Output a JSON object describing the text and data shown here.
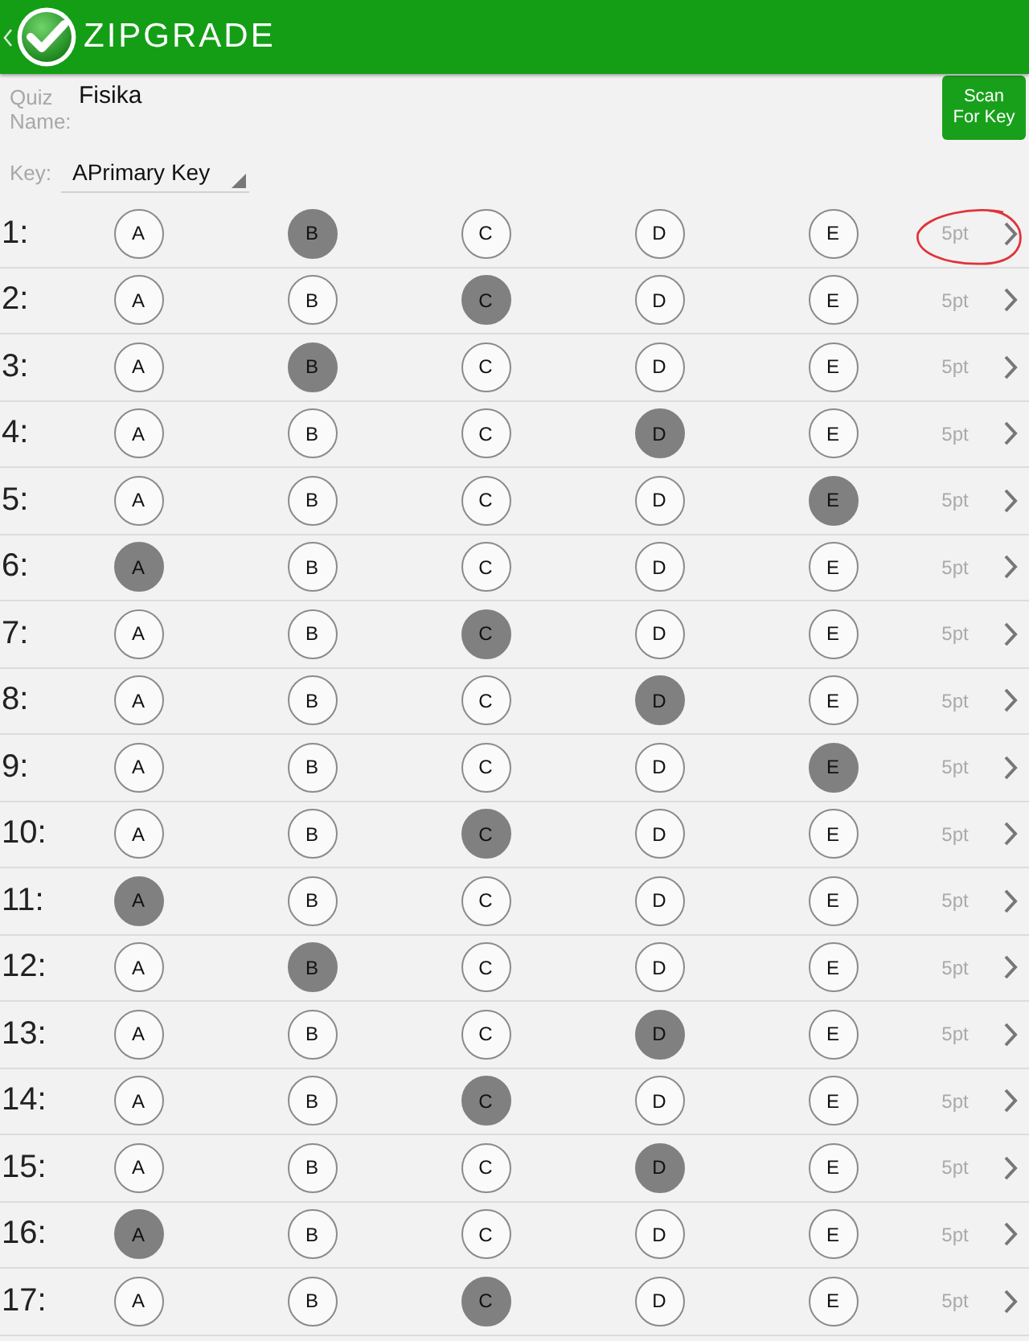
{
  "app_bar": {
    "title": "ZIPGRADE"
  },
  "quiz": {
    "name_label": "Quiz Name:",
    "name": "Fisika",
    "scan_button": "Scan For Key",
    "key_label": "Key:",
    "key": "APrimary Key"
  },
  "questions": [
    {
      "number": "1:",
      "choices": [
        {
          "label": "A",
          "selected": false
        },
        {
          "label": "B",
          "selected": true
        },
        {
          "label": "C",
          "selected": false
        },
        {
          "label": "D",
          "selected": false
        },
        {
          "label": "E",
          "selected": false
        }
      ],
      "points": "5pt",
      "circled": true
    },
    {
      "number": "2:",
      "choices": [
        {
          "label": "A",
          "selected": false
        },
        {
          "label": "B",
          "selected": false
        },
        {
          "label": "C",
          "selected": true
        },
        {
          "label": "D",
          "selected": false
        },
        {
          "label": "E",
          "selected": false
        }
      ],
      "points": "5pt",
      "circled": false
    },
    {
      "number": "3:",
      "choices": [
        {
          "label": "A",
          "selected": false
        },
        {
          "label": "B",
          "selected": true
        },
        {
          "label": "C",
          "selected": false
        },
        {
          "label": "D",
          "selected": false
        },
        {
          "label": "E",
          "selected": false
        }
      ],
      "points": "5pt",
      "circled": false
    },
    {
      "number": "4:",
      "choices": [
        {
          "label": "A",
          "selected": false
        },
        {
          "label": "B",
          "selected": false
        },
        {
          "label": "C",
          "selected": false
        },
        {
          "label": "D",
          "selected": true
        },
        {
          "label": "E",
          "selected": false
        }
      ],
      "points": "5pt",
      "circled": false
    },
    {
      "number": "5:",
      "choices": [
        {
          "label": "A",
          "selected": false
        },
        {
          "label": "B",
          "selected": false
        },
        {
          "label": "C",
          "selected": false
        },
        {
          "label": "D",
          "selected": false
        },
        {
          "label": "E",
          "selected": true
        }
      ],
      "points": "5pt",
      "circled": false
    },
    {
      "number": "6:",
      "choices": [
        {
          "label": "A",
          "selected": true
        },
        {
          "label": "B",
          "selected": false
        },
        {
          "label": "C",
          "selected": false
        },
        {
          "label": "D",
          "selected": false
        },
        {
          "label": "E",
          "selected": false
        }
      ],
      "points": "5pt",
      "circled": false
    },
    {
      "number": "7:",
      "choices": [
        {
          "label": "A",
          "selected": false
        },
        {
          "label": "B",
          "selected": false
        },
        {
          "label": "C",
          "selected": true
        },
        {
          "label": "D",
          "selected": false
        },
        {
          "label": "E",
          "selected": false
        }
      ],
      "points": "5pt",
      "circled": false
    },
    {
      "number": "8:",
      "choices": [
        {
          "label": "A",
          "selected": false
        },
        {
          "label": "B",
          "selected": false
        },
        {
          "label": "C",
          "selected": false
        },
        {
          "label": "D",
          "selected": true
        },
        {
          "label": "E",
          "selected": false
        }
      ],
      "points": "5pt",
      "circled": false
    },
    {
      "number": "9:",
      "choices": [
        {
          "label": "A",
          "selected": false
        },
        {
          "label": "B",
          "selected": false
        },
        {
          "label": "C",
          "selected": false
        },
        {
          "label": "D",
          "selected": false
        },
        {
          "label": "E",
          "selected": true
        }
      ],
      "points": "5pt",
      "circled": false
    },
    {
      "number": "10:",
      "choices": [
        {
          "label": "A",
          "selected": false
        },
        {
          "label": "B",
          "selected": false
        },
        {
          "label": "C",
          "selected": true
        },
        {
          "label": "D",
          "selected": false
        },
        {
          "label": "E",
          "selected": false
        }
      ],
      "points": "5pt",
      "circled": false
    },
    {
      "number": "11:",
      "choices": [
        {
          "label": "A",
          "selected": true
        },
        {
          "label": "B",
          "selected": false
        },
        {
          "label": "C",
          "selected": false
        },
        {
          "label": "D",
          "selected": false
        },
        {
          "label": "E",
          "selected": false
        }
      ],
      "points": "5pt",
      "circled": false
    },
    {
      "number": "12:",
      "choices": [
        {
          "label": "A",
          "selected": false
        },
        {
          "label": "B",
          "selected": true
        },
        {
          "label": "C",
          "selected": false
        },
        {
          "label": "D",
          "selected": false
        },
        {
          "label": "E",
          "selected": false
        }
      ],
      "points": "5pt",
      "circled": false
    },
    {
      "number": "13:",
      "choices": [
        {
          "label": "A",
          "selected": false
        },
        {
          "label": "B",
          "selected": false
        },
        {
          "label": "C",
          "selected": false
        },
        {
          "label": "D",
          "selected": true
        },
        {
          "label": "E",
          "selected": false
        }
      ],
      "points": "5pt",
      "circled": false
    },
    {
      "number": "14:",
      "choices": [
        {
          "label": "A",
          "selected": false
        },
        {
          "label": "B",
          "selected": false
        },
        {
          "label": "C",
          "selected": true
        },
        {
          "label": "D",
          "selected": false
        },
        {
          "label": "E",
          "selected": false
        }
      ],
      "points": "5pt",
      "circled": false
    },
    {
      "number": "15:",
      "choices": [
        {
          "label": "A",
          "selected": false
        },
        {
          "label": "B",
          "selected": false
        },
        {
          "label": "C",
          "selected": false
        },
        {
          "label": "D",
          "selected": true
        },
        {
          "label": "E",
          "selected": false
        }
      ],
      "points": "5pt",
      "circled": false
    },
    {
      "number": "16:",
      "choices": [
        {
          "label": "A",
          "selected": true
        },
        {
          "label": "B",
          "selected": false
        },
        {
          "label": "C",
          "selected": false
        },
        {
          "label": "D",
          "selected": false
        },
        {
          "label": "E",
          "selected": false
        }
      ],
      "points": "5pt",
      "circled": false
    },
    {
      "number": "17:",
      "choices": [
        {
          "label": "A",
          "selected": false
        },
        {
          "label": "B",
          "selected": false
        },
        {
          "label": "C",
          "selected": true
        },
        {
          "label": "D",
          "selected": false
        },
        {
          "label": "E",
          "selected": false
        }
      ],
      "points": "5pt",
      "circled": false
    }
  ]
}
